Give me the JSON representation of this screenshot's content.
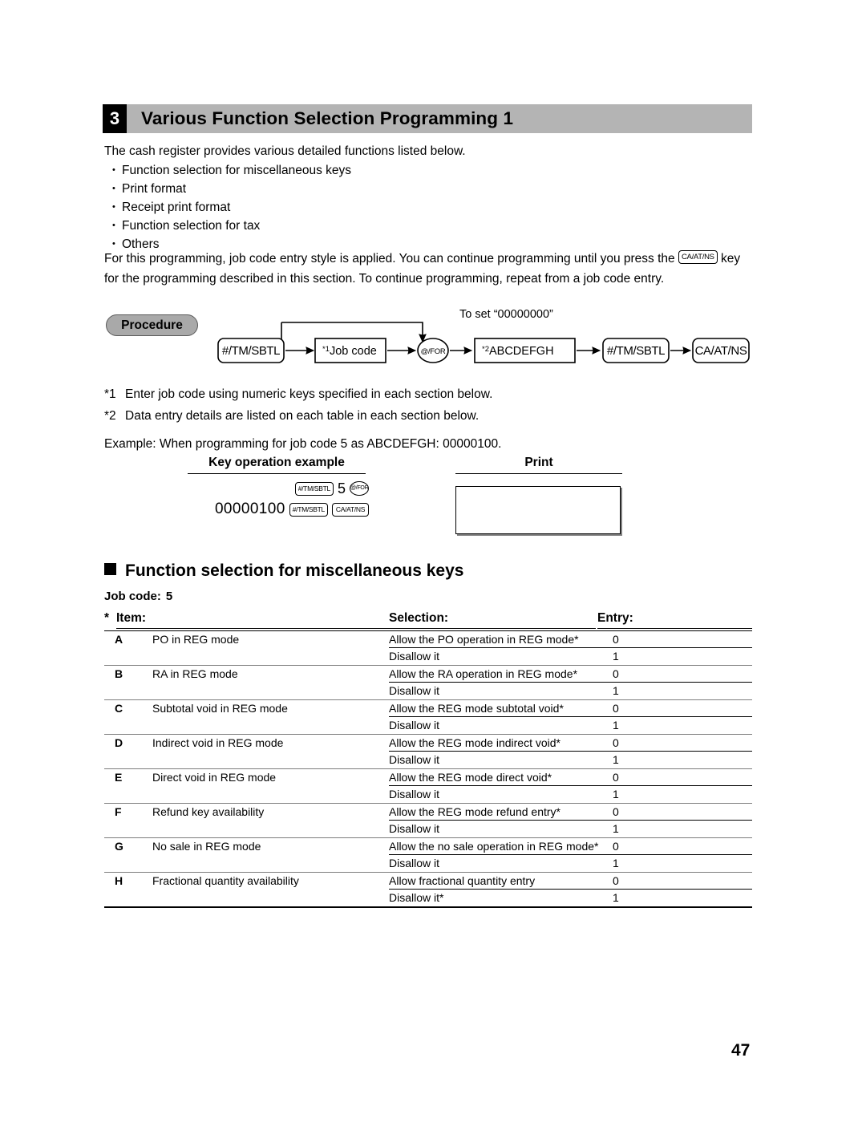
{
  "header": {
    "number": "3",
    "title": "Various Function Selection Programming 1"
  },
  "intro": {
    "lead": "The cash register provides various detailed functions listed below.",
    "bullets": [
      "Function selection for miscellaneous keys",
      "Print format",
      "Receipt print format",
      "Function selection for tax",
      "Others"
    ],
    "para_part1": "For this programming, job code entry style is applied.  You can continue programming until you press the",
    "inline_key": "CA/AT/NS",
    "para_part2": "key for the programming described in this section.  To continue programming, repeat from a job code entry."
  },
  "procedure": {
    "badge": "Procedure",
    "bypass_label": "To set “00000000”",
    "nodes": [
      {
        "label": "#/TM/SBTL",
        "shape": "rounded-key"
      },
      {
        "sup": "*1",
        "label": "Job code",
        "shape": "rect"
      },
      {
        "label": "@/FOR",
        "shape": "circle"
      },
      {
        "sup": "*2",
        "label": "ABCDEFGH",
        "shape": "rect"
      },
      {
        "label": "#/TM/SBTL",
        "shape": "rounded-key"
      },
      {
        "label": "CA/AT/NS",
        "shape": "rounded-key"
      }
    ]
  },
  "footnotes": [
    {
      "index": "*1",
      "text": "Enter job code using numeric keys specified in each section below."
    },
    {
      "index": "*2",
      "text": "Data entry details are listed on each table in each section below."
    }
  ],
  "example": {
    "intro": "Example:  When programming for job code 5 as ABCDEFGH: 00000100.",
    "col_key_operation": "Key operation example",
    "col_print": "Print",
    "keys_row1": [
      "#/TM/SBTL",
      "5",
      "@/FOR"
    ],
    "keys_row2_value": "00000100",
    "keys_row2": [
      "#/TM/SBTL",
      "CA/AT/NS"
    ],
    "print_content": ""
  },
  "subsection": {
    "title": "Function selection for miscellaneous keys",
    "job_code_label": "Job code:",
    "job_code_value": "5"
  },
  "table": {
    "star": "*",
    "columns": [
      "Item:",
      "Selection:",
      "Entry:"
    ],
    "rows": [
      {
        "letter": "A",
        "item": "PO in REG mode",
        "options": [
          {
            "selection": "Allow the PO operation in REG mode*",
            "entry": "0"
          },
          {
            "selection": "Disallow it",
            "entry": "1"
          }
        ]
      },
      {
        "letter": "B",
        "item": "RA in REG mode",
        "options": [
          {
            "selection": "Allow the RA operation in REG mode*",
            "entry": "0"
          },
          {
            "selection": "Disallow it",
            "entry": "1"
          }
        ]
      },
      {
        "letter": "C",
        "item": "Subtotal void in REG mode",
        "options": [
          {
            "selection": "Allow the REG mode subtotal void*",
            "entry": "0"
          },
          {
            "selection": "Disallow it",
            "entry": "1"
          }
        ]
      },
      {
        "letter": "D",
        "item": "Indirect void in REG mode",
        "options": [
          {
            "selection": "Allow the REG mode indirect void*",
            "entry": "0"
          },
          {
            "selection": "Disallow it",
            "entry": "1"
          }
        ]
      },
      {
        "letter": "E",
        "item": "Direct void in REG mode",
        "options": [
          {
            "selection": "Allow the REG mode direct void*",
            "entry": "0"
          },
          {
            "selection": "Disallow it",
            "entry": "1"
          }
        ]
      },
      {
        "letter": "F",
        "item": "Refund key availability",
        "options": [
          {
            "selection": "Allow the REG mode refund entry*",
            "entry": "0"
          },
          {
            "selection": "Disallow it",
            "entry": "1"
          }
        ]
      },
      {
        "letter": "G",
        "item": "No sale in REG mode",
        "options": [
          {
            "selection": "Allow the no sale operation in REG mode*",
            "entry": "0"
          },
          {
            "selection": "Disallow it",
            "entry": "1"
          }
        ]
      },
      {
        "letter": "H",
        "item": "Fractional quantity availability",
        "options": [
          {
            "selection": "Allow fractional quantity entry",
            "entry": "0"
          },
          {
            "selection": "Disallow it*",
            "entry": "1"
          }
        ]
      }
    ]
  },
  "footer": {
    "page_number": "47"
  },
  "colors": {
    "header_bar": "#b4b4b4",
    "badge_fill": "#a9a9a9",
    "rule": "#7d7d7d"
  }
}
